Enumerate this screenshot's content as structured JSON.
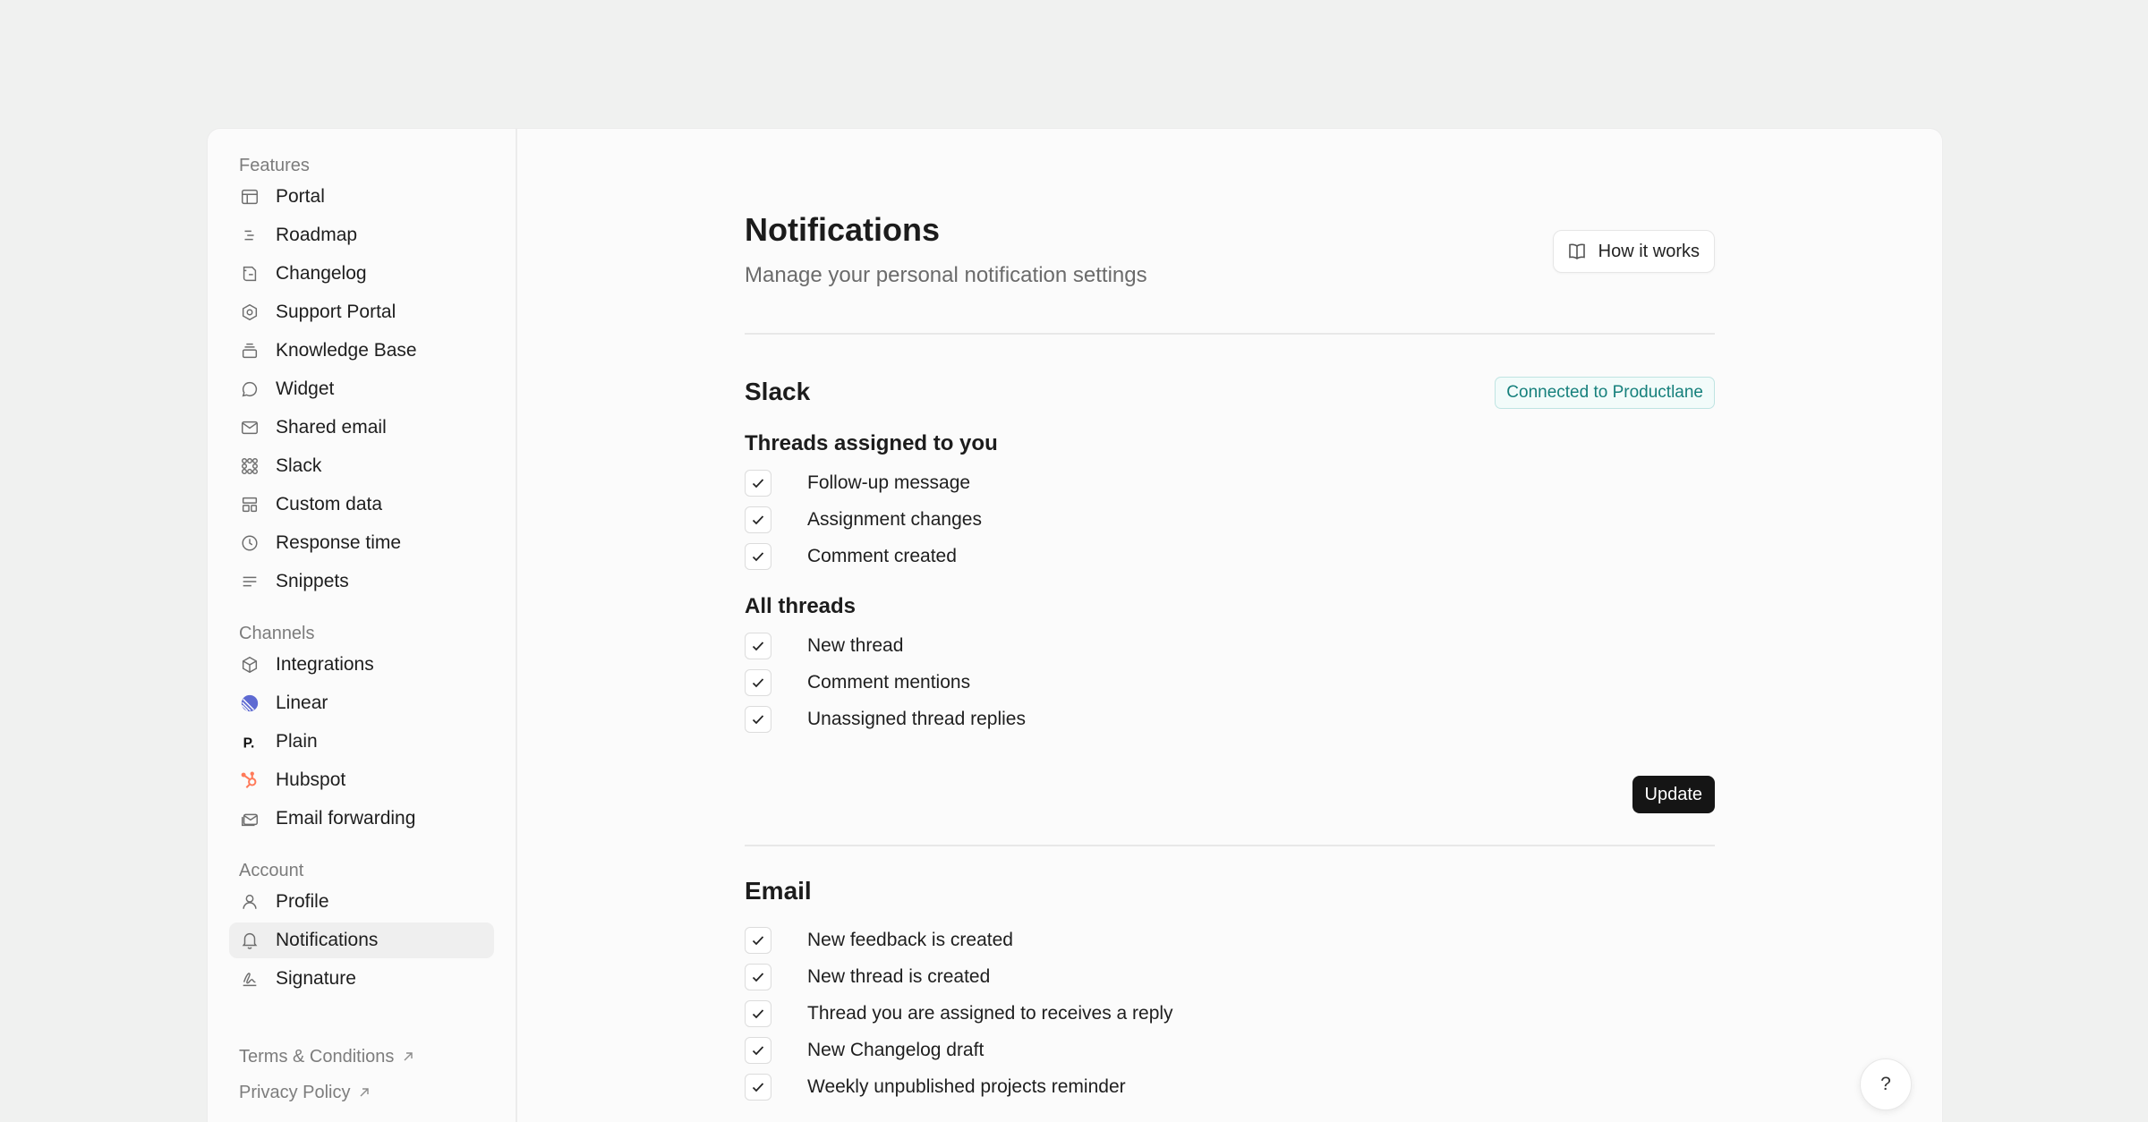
{
  "sidebar": {
    "features_label": "Features",
    "features": [
      {
        "label": "Portal",
        "icon": "layout-icon"
      },
      {
        "label": "Roadmap",
        "icon": "roadmap-icon"
      },
      {
        "label": "Changelog",
        "icon": "changelog-icon"
      },
      {
        "label": "Support Portal",
        "icon": "hexagon-icon"
      },
      {
        "label": "Knowledge Base",
        "icon": "stack-icon"
      },
      {
        "label": "Widget",
        "icon": "chat-bubble-icon"
      },
      {
        "label": "Shared email",
        "icon": "mail-icon"
      },
      {
        "label": "Slack",
        "icon": "slack-icon"
      },
      {
        "label": "Custom data",
        "icon": "custom-data-icon"
      },
      {
        "label": "Response time",
        "icon": "clock-icon"
      },
      {
        "label": "Snippets",
        "icon": "text-lines-icon"
      }
    ],
    "channels_label": "Channels",
    "channels": [
      {
        "label": "Integrations",
        "icon": "cube-icon"
      },
      {
        "label": "Linear",
        "icon": "linear-logo-icon"
      },
      {
        "label": "Plain",
        "icon": "plain-logo-icon"
      },
      {
        "label": "Hubspot",
        "icon": "hubspot-logo-icon"
      },
      {
        "label": "Email forwarding",
        "icon": "mail-forward-icon"
      }
    ],
    "account_label": "Account",
    "account": [
      {
        "label": "Profile",
        "icon": "user-icon"
      },
      {
        "label": "Notifications",
        "icon": "bell-icon",
        "active": true
      },
      {
        "label": "Signature",
        "icon": "signature-icon"
      }
    ],
    "footer": {
      "terms": "Terms & Conditions",
      "privacy": "Privacy Policy"
    }
  },
  "header": {
    "title": "Notifications",
    "subtitle": "Manage your personal notification settings",
    "how_it_works": "How it works"
  },
  "slack": {
    "title": "Slack",
    "badge": "Connected to Productlane",
    "assigned_title": "Threads assigned to you",
    "assigned": [
      {
        "label": "Follow-up message",
        "checked": true
      },
      {
        "label": "Assignment changes",
        "checked": true
      },
      {
        "label": "Comment created",
        "checked": true
      }
    ],
    "all_title": "All threads",
    "all": [
      {
        "label": "New thread",
        "checked": true
      },
      {
        "label": "Comment mentions",
        "checked": true
      },
      {
        "label": "Unassigned thread replies",
        "checked": true
      }
    ],
    "update_label": "Update"
  },
  "email": {
    "title": "Email",
    "items": [
      {
        "label": "New feedback is created",
        "checked": true
      },
      {
        "label": "New thread is created",
        "checked": true
      },
      {
        "label": "Thread you are assigned to receives a reply",
        "checked": true
      },
      {
        "label": "New Changelog draft",
        "checked": true
      },
      {
        "label": "Weekly unpublished projects reminder",
        "checked": true
      }
    ]
  },
  "help": {
    "label": "?"
  },
  "colors": {
    "accent_badge": "#16807c",
    "primary_button": "#151515"
  }
}
